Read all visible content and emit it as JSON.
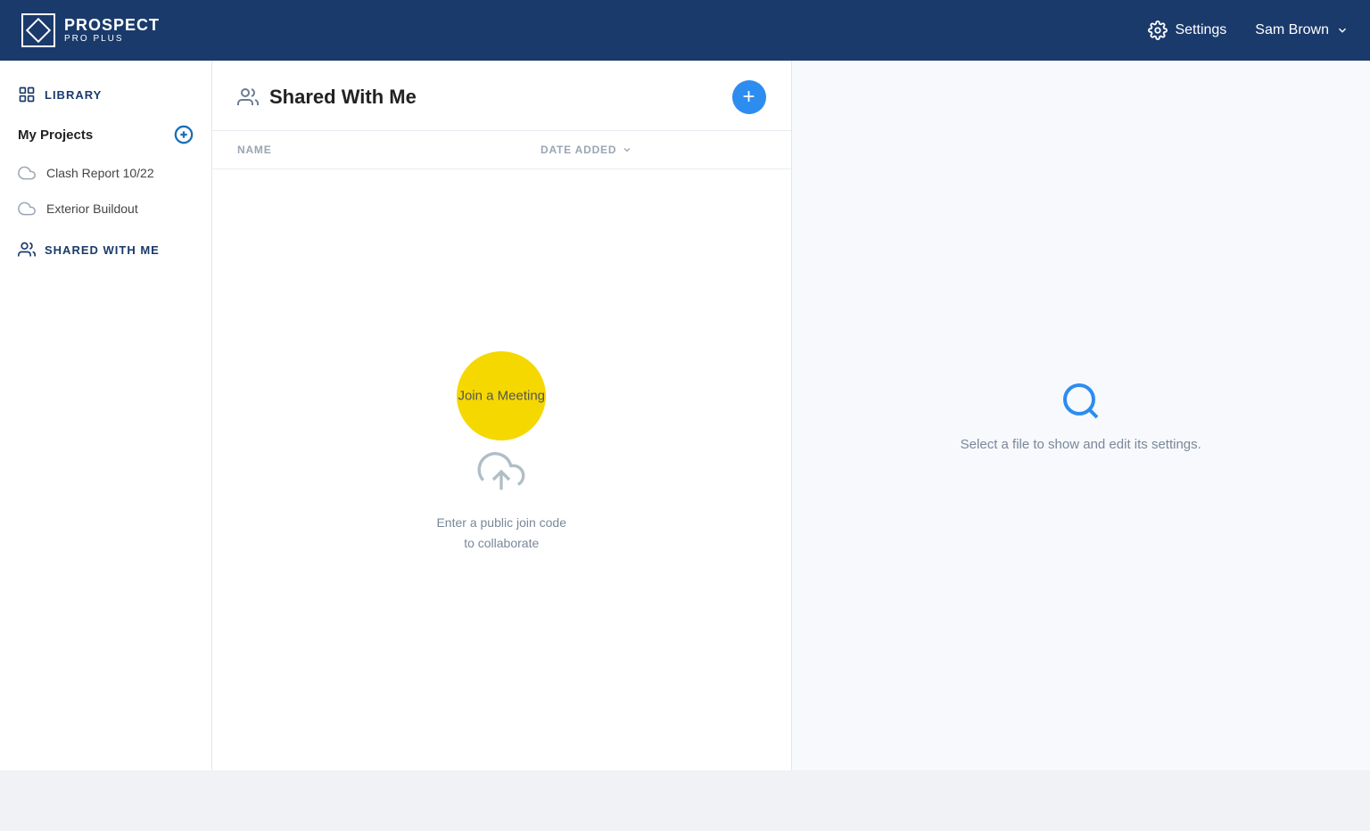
{
  "header": {
    "logo_text": "PROSPECT",
    "logo_subtext": "PRO PLUS",
    "settings_label": "Settings",
    "user_name": "Sam Brown"
  },
  "sidebar": {
    "library_label": "LIBRARY",
    "my_projects_label": "My Projects",
    "projects": [
      {
        "name": "Clash Report 10/22"
      },
      {
        "name": "Exterior Buildout"
      }
    ],
    "shared_label": "SHARED WITH ME"
  },
  "content": {
    "title": "Shared With Me",
    "table": {
      "col_name": "NAME",
      "col_date": "DATE ADDED"
    },
    "empty": {
      "join_meeting_label": "Join a Meeting",
      "empty_text_line1": "Enter a public join code",
      "empty_text_line2": "to collaborate"
    }
  },
  "right_panel": {
    "text": "Select a file to show and edit its settings."
  }
}
